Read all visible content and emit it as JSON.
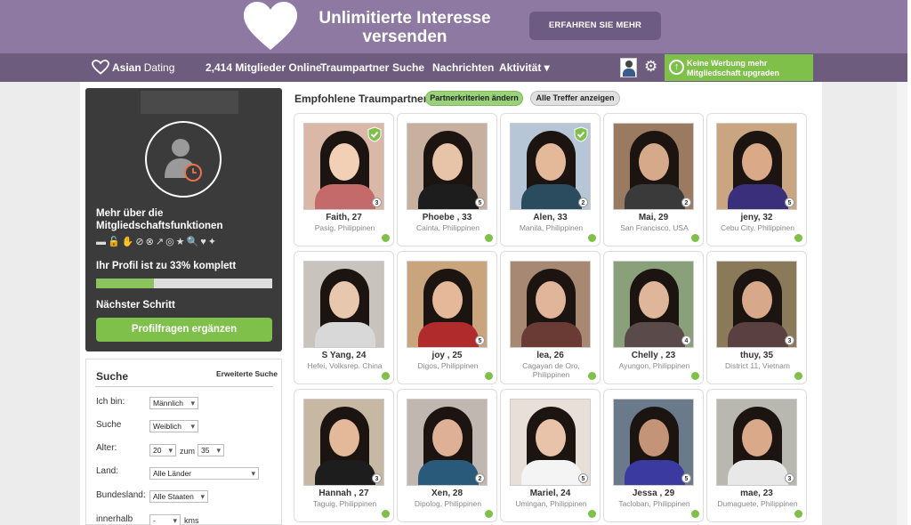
{
  "banner": {
    "headline_line1": "Unlimitierte Interesse",
    "headline_line2": "versenden",
    "cta": "ERFAHREN SIE MEHR"
  },
  "nav": {
    "logo_asian": "Asian",
    "logo_dating": "Dating",
    "members_online": "2,414 Mitglieder Online",
    "items": [
      "Traumpartner",
      "Suche",
      "Nachrichten",
      "Aktivität ▾"
    ],
    "upgrade_line1": "Keine Werbung mehr",
    "upgrade_line2": "Mitgliedschaft upgraden"
  },
  "profile": {
    "more_features": "Mehr über die Mitgliedschaftsfunktionen",
    "complete_text": "Ihr Profil ist zu 33% komplett",
    "complete_fraction": 0.33,
    "next_step": "Nächster Schritt",
    "button": "Profilfragen ergänzen"
  },
  "search": {
    "title": "Suche",
    "advanced": "Erweiterte Suche",
    "i_am_label": "Ich bin:",
    "i_am_value": "Männlich",
    "seek_label": "Suche",
    "seek_value": "Weiblich",
    "age_label": "Alter:",
    "age_from": "20",
    "age_to_label": "zum",
    "age_to": "35",
    "country_label": "Land:",
    "country_value": "Alle Länder",
    "state_label": "Bundesland:",
    "state_value": "Alle Staaten",
    "within_label": "innerhalb",
    "within_value": "-",
    "unit": "kms"
  },
  "recommended": {
    "title": "Empfohlene Traumpartner",
    "btn_edit": "Partnerkriterien ändern",
    "btn_all": "Alle Treffer anzeigen"
  },
  "members": [
    {
      "name": "Faith, 27",
      "loc": "Pasig, Philippinen",
      "photos": "3",
      "verified": true
    },
    {
      "name": "Phoebe , 33",
      "loc": "Cainta, Philippinen",
      "photos": "5",
      "verified": false
    },
    {
      "name": "Alen, 33",
      "loc": "Manila, Philippinen",
      "photos": "2",
      "verified": true
    },
    {
      "name": "Mai, 29",
      "loc": "San Francisco, USA",
      "photos": "2",
      "verified": false
    },
    {
      "name": "jeny, 32",
      "loc": "Cebu City, Philippinen",
      "photos": "5",
      "verified": false
    },
    {
      "name": "S Yang, 24",
      "loc": "Hefei, Volksrep. China",
      "photos": "",
      "verified": false
    },
    {
      "name": "joy , 25",
      "loc": "Digos, Philippinen",
      "photos": "5",
      "verified": false
    },
    {
      "name": "lea, 26",
      "loc": "Cagayan de Oro, Philippinen",
      "photos": "",
      "verified": false
    },
    {
      "name": "Chelly , 23",
      "loc": "Ayungon, Philippinen",
      "photos": "4",
      "verified": false
    },
    {
      "name": "thuy, 35",
      "loc": "District 11, Vietnam",
      "photos": "3",
      "verified": false
    },
    {
      "name": "Hannah , 27",
      "loc": "Taguig, Philippinen",
      "photos": "3",
      "verified": false
    },
    {
      "name": "Xen, 28",
      "loc": "Dipolog, Philippinen",
      "photos": "2",
      "verified": false
    },
    {
      "name": "Mariel, 24",
      "loc": "Umingan, Philippinen",
      "photos": "5",
      "verified": false
    },
    {
      "name": "Jessa , 29",
      "loc": "Tacloban, Philippinen",
      "photos": "5",
      "verified": false
    },
    {
      "name": "mae, 23",
      "loc": "Dumaguete, Philippinen",
      "photos": "3",
      "verified": false
    }
  ],
  "colors": {
    "banner": "#8d79a1",
    "nav": "#6d5c7e",
    "accent_green": "#7ec04a",
    "online_dot": "#7ec04a"
  }
}
